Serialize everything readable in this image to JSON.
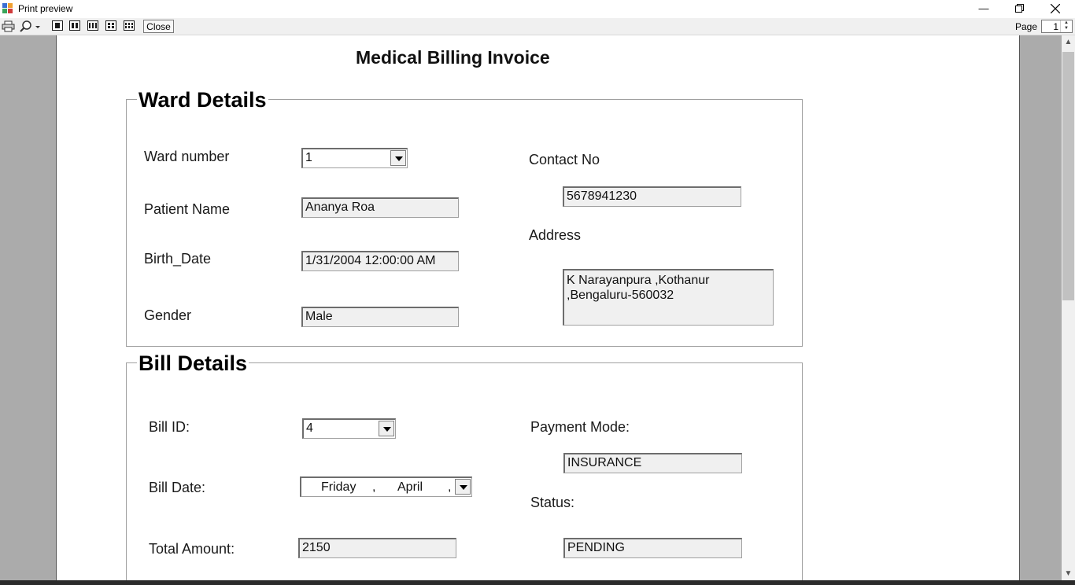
{
  "window": {
    "title": "Print preview"
  },
  "toolbar": {
    "close_label": "Close",
    "page_label": "Page",
    "page_value": "1"
  },
  "document": {
    "heading": "Medical Billing Invoice",
    "ward": {
      "title": "Ward Details",
      "ward_number_label": "Ward number",
      "ward_number_value": "1",
      "patient_name_label": "Patient Name",
      "patient_name_value": "Ananya Roa",
      "birth_date_label": "Birth_Date",
      "birth_date_value": "1/31/2004 12:00:00 AM",
      "gender_label": "Gender",
      "gender_value": "Male",
      "contact_label": "Contact No",
      "contact_value": "5678941230",
      "address_label": "Address",
      "address_value": "K Narayanpura ,Kothanur ,Bengaluru-560032"
    },
    "bill": {
      "title": "Bill Details",
      "bill_id_label": "Bill ID:",
      "bill_id_value": "4",
      "bill_date_label": "Bill Date:",
      "bill_date_day": "Friday",
      "bill_date_sep": ",",
      "bill_date_month": "April",
      "bill_date_tail": ",",
      "total_label": "Total Amount:",
      "total_value": "2150",
      "payment_label": "Payment Mode:",
      "payment_value": "INSURANCE",
      "status_label": "Status:",
      "status_value": "PENDING"
    }
  }
}
